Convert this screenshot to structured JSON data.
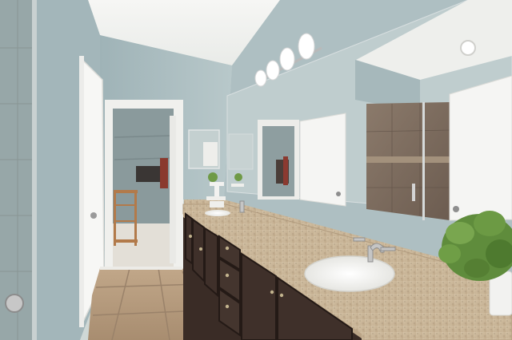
{
  "scene": {
    "colors": {
      "ceiling": "#f1f2f0",
      "wall": "#a9bcc0",
      "wall_light": "#b9cacc",
      "door": "#f7f7f5",
      "door_frame": "#efefec",
      "floor_tile": "#b69b7e",
      "floor_grout": "#9c8469",
      "countertop": "#cbb89c",
      "cabinet": "#3a2c26",
      "sink": "#f4f4f1",
      "glass": "#8d9ea0",
      "shower_tile": "#7e6d5f",
      "closet_floor": "#e6e3db",
      "plant": "#5f8c3c",
      "light_glass": "#ffffff",
      "fixture_metal": "#b9b9b9"
    },
    "icons": [
      "vanity-light-icon",
      "faucet-icon",
      "plant-icon"
    ]
  }
}
